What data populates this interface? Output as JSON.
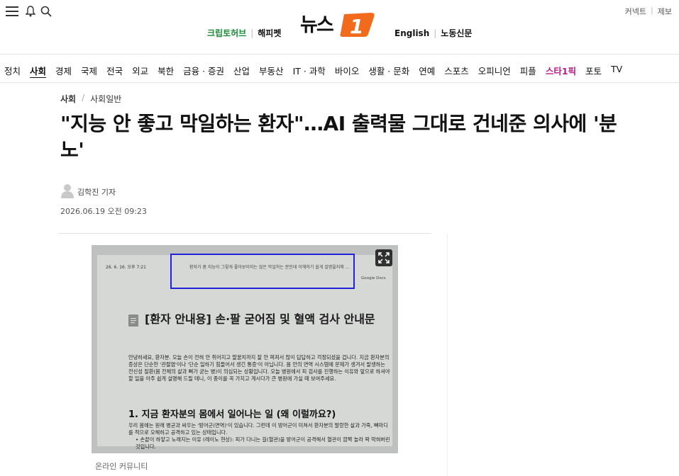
{
  "header": {
    "top_links": [
      "커넥트",
      "제보"
    ],
    "left_links": [
      "크립토허브",
      "해피펫"
    ],
    "right_links": [
      "English",
      "노동신문"
    ],
    "logo_text": "뉴스1"
  },
  "nav": {
    "items": [
      "정치",
      "사회",
      "경제",
      "국제",
      "전국",
      "외교",
      "북한",
      "금융 · 증권",
      "산업",
      "부동산",
      "IT · 과학",
      "바이오",
      "생활 · 문화",
      "연예",
      "스포츠",
      "오피니언",
      "피플",
      "스타1픽",
      "포토",
      "TV"
    ],
    "active": "사회"
  },
  "article": {
    "breadcrumb": [
      "사회",
      "사회일반"
    ],
    "title": "\"지능 안 좋고 막일하는 환자\"…AI 출력물 그대로 건네준 의사에 '분노'",
    "author": "김학진 기자",
    "date": "2026.06.19 오전 09:23",
    "caption": "온라인 커뮤니티"
  },
  "photo": {
    "doc_date": "26. 6. 16. 오후 7:21",
    "doc_top": "환자가 좀 지능이 그렇게 좋아보이지는 않은 막일하는 분인데 이해하기 쉽게 설명을지해 ...",
    "doc_source": "Google Docs",
    "doc_title": "[환자 안내용] 손·팔 굳어짐 및 혈액 검사 안내문",
    "doc_para1": "안녕하세요, 환자분. 오늘 손이 전혀 안 쥐어지고 팔꿈치까지 잘 안 펴져서 많이 답답하고 걱정되셨을 겁니다. 지금 환자분의 증상은 단순한 '관절염'이나 '단순 일하기 힘들어서 생긴 통증'이 아닙니다. 몸 안의 면역 시스템에 문제가 생겨서 발생하는 전신성 질환(몸 전체의 살과 뼈가 굳는 병)이 의심되는 상황입니다. 오늘 병원에서 피 검사를 진행하는 이유와 앞으로 하셔야 할 일을 아주 쉽게 설명해 드릴 테니, 이 종이를 꼭 가지고 계시다가 큰 병원에 가실 때 보여주세요.",
    "doc_h2": "1. 지금 환자분의 몸에서 일어나는 일 (왜 이럴까요?)",
    "doc_para2": "우리 몸에는 원래 병균과 싸우는 '방어군(면역)'이 있습니다. 그런데 이 방어군이 미쳐서 환자분의 말랑한 살과 가죽, 뼈마디를 적으로 오해하고 공격하고 있는 상태입니다.",
    "doc_bullet": "• 손끝이 하얗고 노래지는 이유 (레이노 현상): 피가 다니는 길(혈관)을 방어군이 공격해서 혈관이 깜짝 놀라 꽉 막혀버린 것입니다."
  }
}
